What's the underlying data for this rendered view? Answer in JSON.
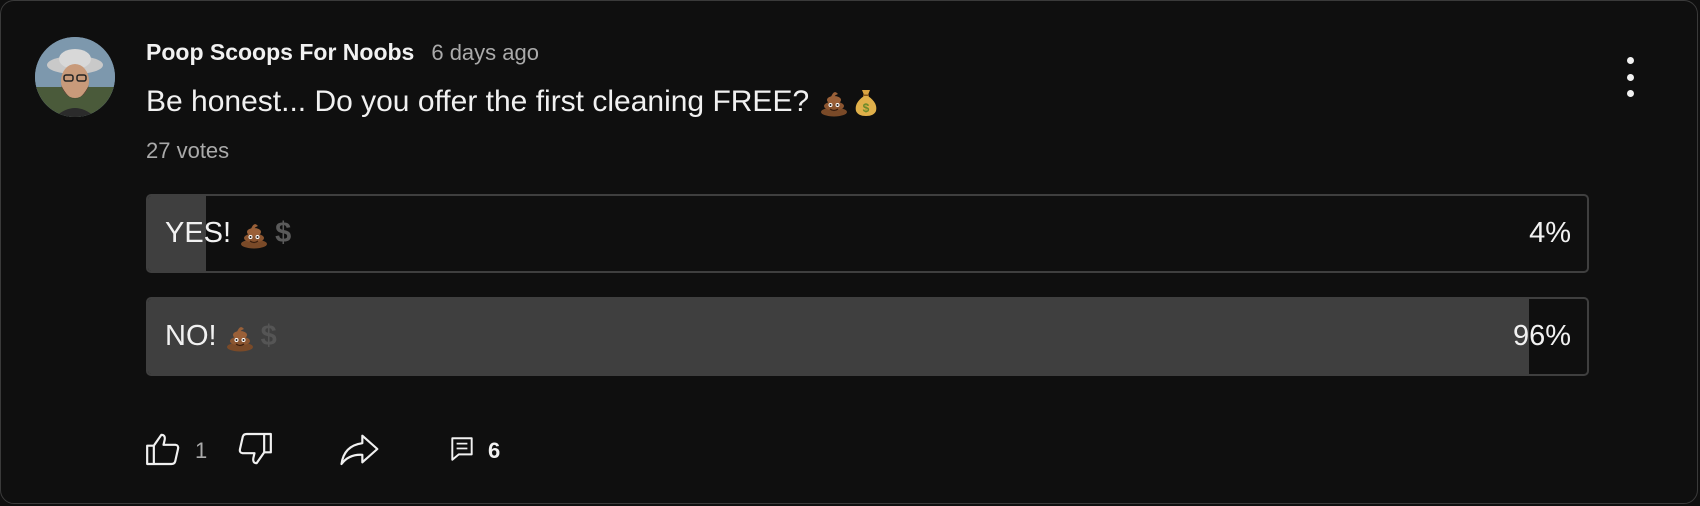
{
  "post": {
    "author": "Poop Scoops For Noobs",
    "time": "6 days ago",
    "question": "Be honest... Do you offer the first cleaning FREE?",
    "question_emoji": [
      "pile-of-poo-icon",
      "money-bag-icon"
    ],
    "votes": "27 votes"
  },
  "poll": {
    "options": [
      {
        "label": "YES!",
        "percent": "4%",
        "fill_fraction": 0.04
      },
      {
        "label": "NO!",
        "percent": "96%",
        "fill_fraction": 0.96
      }
    ]
  },
  "actions": {
    "like_count": "1",
    "comment_count": "6"
  },
  "colors": {
    "background": "#0f0f0f",
    "bar_fill": "#3f3f3f",
    "text": "#f1f1f1",
    "muted": "#aaaaaa"
  }
}
